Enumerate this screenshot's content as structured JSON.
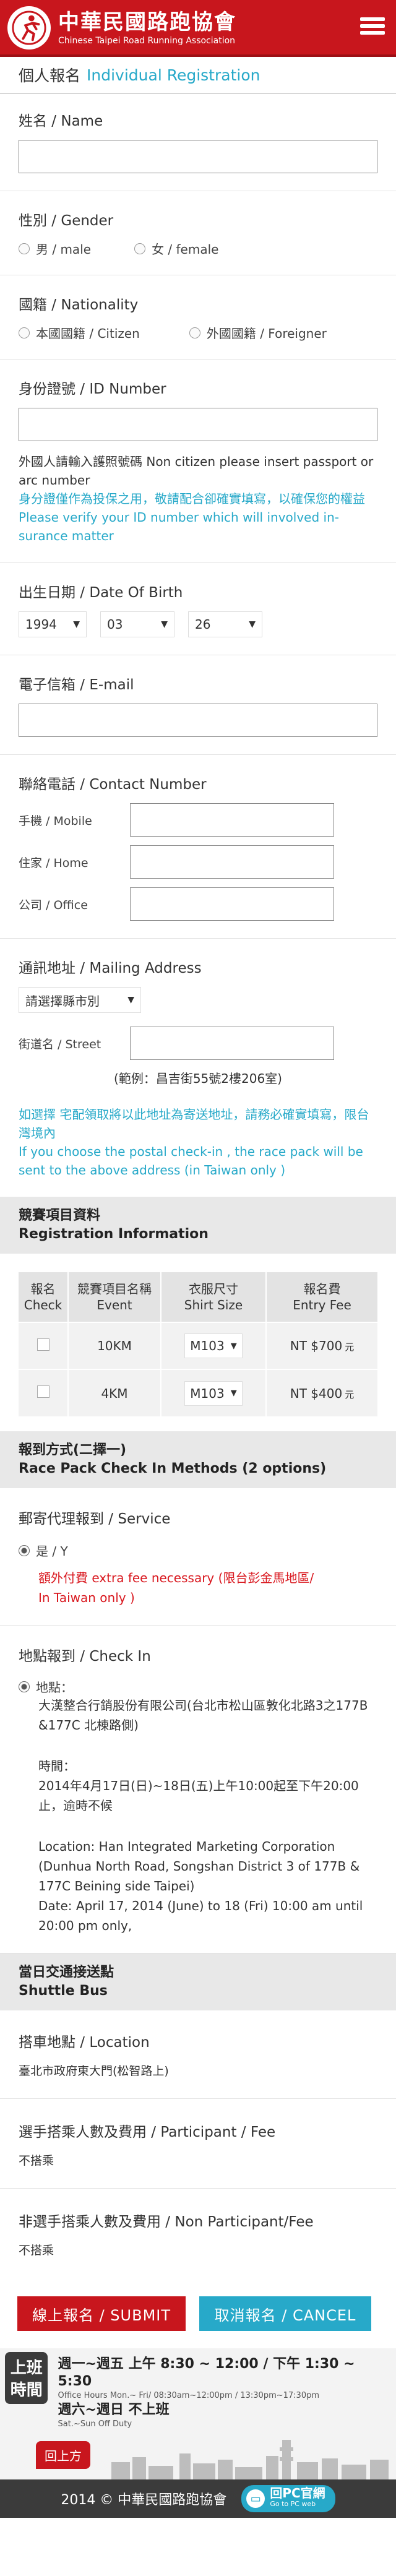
{
  "header": {
    "brand_cn": "中華民國路跑協會",
    "brand_en": "Chinese Taipei Road Running Association"
  },
  "page": {
    "title_cn": "個人報名",
    "title_en": "Individual Registration"
  },
  "name": {
    "label": "姓名 / Name",
    "value": ""
  },
  "gender": {
    "label": "性別 / Gender",
    "options": [
      "男 / male",
      "女 / female"
    ]
  },
  "nationality": {
    "label": "國籍 / Nationality",
    "options": [
      "本國國籍 / Citizen",
      "外國國籍 / Foreigner"
    ]
  },
  "id_number": {
    "label": "身份證號 / ID Number",
    "value": "",
    "help_1": "外國人請輸入護照號碼 Non citizen please insert passport or arc number",
    "help_2": "身分證僅作為投保之用，敬請配合卻確實填寫，以確保您的權益 Please verify your ID number which will involved in-surance matter"
  },
  "dob": {
    "label": "出生日期 / Date Of Birth",
    "year": "1994",
    "month": "03",
    "day": "26"
  },
  "email": {
    "label": "電子信箱 / E-mail",
    "value": ""
  },
  "contact": {
    "label": "聯絡電話 / Contact Number",
    "mobile": "手機 / Mobile",
    "home": "住家 / Home",
    "office": "公司 / Office"
  },
  "mailing": {
    "label": "通訊地址 / Mailing Address",
    "county_select": "請選擇縣市別",
    "street": "街道名 / Street",
    "example": "(範例：昌吉街55號2樓206室)",
    "note_cn": "如選擇 宅配領取將以此地址為寄送地址，請務必確實填寫，限台灣境內",
    "note_en": "If you choose the postal check-in , the race pack will be sent to  the above address (in Taiwan only )"
  },
  "registration": {
    "header_cn": "競賽項目資料",
    "header_en": "Registration Information",
    "columns": [
      [
        "報名",
        "Check"
      ],
      [
        "競賽項目名稱",
        "Event"
      ],
      [
        "衣服尺寸",
        "Shirt Size"
      ],
      [
        "報名費",
        "Entry Fee"
      ]
    ],
    "rows": [
      {
        "event": "10KM",
        "size": "M103",
        "fee": "NT $700",
        "currency": "元"
      },
      {
        "event": "4KM",
        "size": "M103",
        "fee": "NT $400",
        "currency": "元"
      }
    ]
  },
  "checkin": {
    "header_cn": "報到方式(二擇一)",
    "header_en": "Race Pack Check In Methods (2 options)",
    "service_label": "郵寄代理報到 / Service",
    "service_yes": "是 / Y",
    "service_fee_1": "額外付費 extra fee necessary",
    "service_fee_2": "(限台彭金馬地區/",
    "service_fee_3": "In Taiwan only )",
    "onsite_label": "地點報到 / Check In",
    "place_label": "地點：",
    "place_cn": "大漢整合行銷股份有限公司(台北市松山區敦化北路3之177B &177C 北棟路側)",
    "time_cn": "時間：",
    "time_detail_cn": "2014年4月17日(日)~18日(五)上午10:00起至下午20:00止，逾時不候",
    "location_en": "Location: Han Integrated Marketing Corporation (Dunhua North Road, Songshan District 3 of 177B & 177C Beining side Taipei)",
    "date_en": "Date: April 17, 2014 (June) to 18 (Fri) 10:00 am until 20:00 pm only,"
  },
  "shuttle": {
    "header_cn": "當日交通接送點",
    "header_en": "Shuttle Bus",
    "location_label": "搭車地點 / Location",
    "location_value": "臺北市政府東大門(松智路上)",
    "participant_label": "選手搭乘人數及費用 /  Participant / Fee",
    "participant_value": "不搭乘",
    "nonparticipant_label": "非選手搭乘人數及費用  / Non Participant/Fee",
    "nonparticipant_value": "不搭乘"
  },
  "buttons": {
    "submit": "線上報名 / SUBMIT",
    "cancel": "取消報名 / CANCEL"
  },
  "office_hours": {
    "label": "上班時間",
    "line1": "週一~週五 上午 8:30 ~ 12:00 / 下午 1:30 ~ 5:30",
    "line1_en": "Office Hours  Mon.~ Fri/ 08:30am~12:00pm / 13:30pm~17:30pm",
    "line2": "週六~週日 不上班",
    "line2_en": "Sat.~Sun Off Duty"
  },
  "skyline_btn": "回上方",
  "footer": {
    "copyright": "2014 © 中華民國路跑協會",
    "pc_cn": "回PC官網",
    "pc_en": "Go to PC web"
  }
}
